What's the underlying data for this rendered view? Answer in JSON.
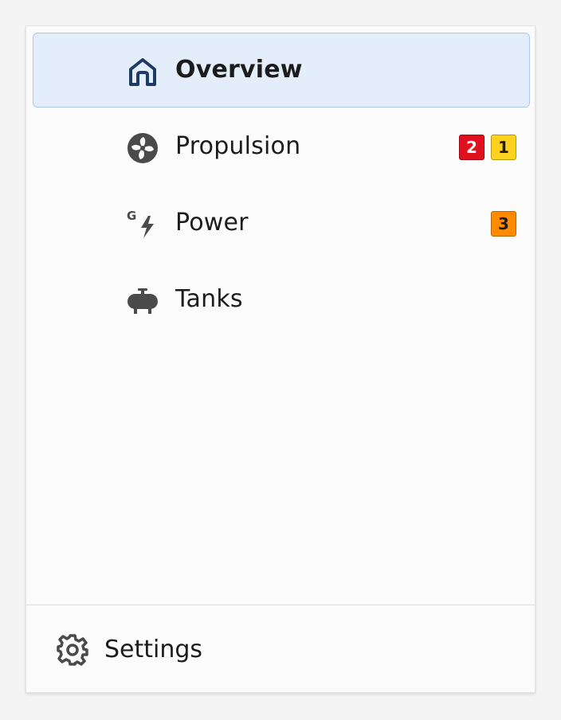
{
  "nav": {
    "items": [
      {
        "label": "Overview",
        "icon": "home-icon",
        "active": true,
        "badges": []
      },
      {
        "label": "Propulsion",
        "icon": "fan-icon",
        "active": false,
        "badges": [
          {
            "count": "2",
            "severity": "critical"
          },
          {
            "count": "1",
            "severity": "caution"
          }
        ]
      },
      {
        "label": "Power",
        "icon": "generator-bolt-icon",
        "active": false,
        "badges": [
          {
            "count": "3",
            "severity": "warning"
          }
        ]
      },
      {
        "label": "Tanks",
        "icon": "tank-icon",
        "active": false,
        "badges": []
      }
    ]
  },
  "footer": {
    "settings_label": "Settings",
    "settings_icon": "gear-icon"
  },
  "colors": {
    "active_background": "#e4eefb",
    "active_border": "#a9c8ee",
    "critical": "#e0101e",
    "warning": "#ff8c00",
    "caution": "#ffd21f",
    "home_icon": "#1e3b66",
    "icon": "#4a4a4a"
  }
}
